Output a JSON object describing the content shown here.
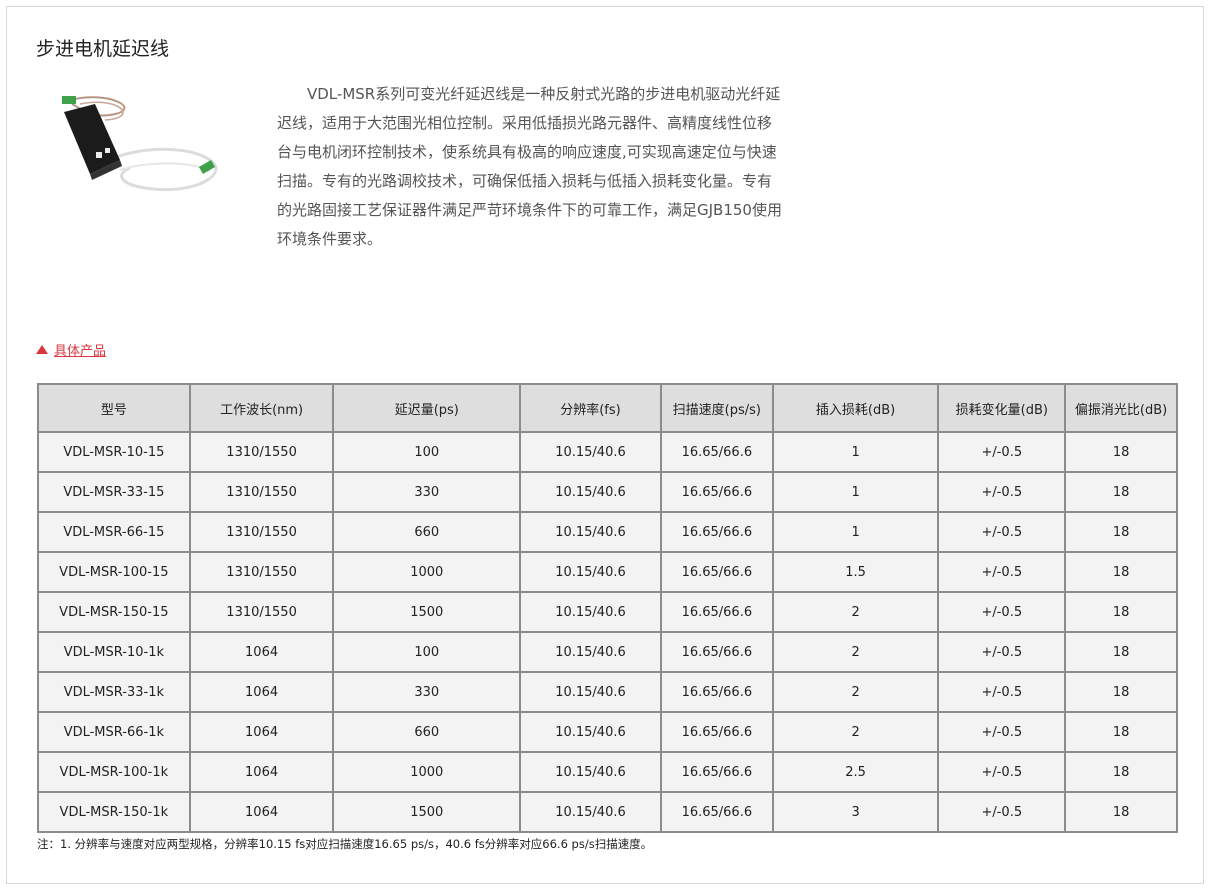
{
  "page": {
    "title": "步进电机延迟线",
    "description": "VDL-MSR系列可变光纤延迟线是一种反射式光路的步进电机驱动光纤延迟线，适用于大范围光相位控制。采用低插损光路元器件、高精度线性位移台与电机闭环控制技术，使系统具有极高的响应速度,可实现高速定位与快速扫描。专有的光路调校技术，可确保低插入损耗与低插入损耗变化量。专有的光路固接工艺保证器件满足严苛环境条件下的可靠工作，满足GJB150使用环境条件要求。",
    "section_link": "具体产品",
    "accent_color": "#d9363e",
    "image_icon": "fiber-delay-line-module"
  },
  "table": {
    "headers": [
      "型号",
      "工作波长(nm)",
      "延迟量(ps)",
      "分辨率(fs)",
      "扫描速度(ps/s)",
      "插入损耗(dB)",
      "损耗变化量(dB)",
      "偏振消光比(dB)"
    ],
    "rows": [
      [
        "VDL-MSR-10-15",
        "1310/1550",
        "100",
        "10.15/40.6",
        "16.65/66.6",
        "1",
        "+/-0.5",
        "18"
      ],
      [
        "VDL-MSR-33-15",
        "1310/1550",
        "330",
        "10.15/40.6",
        "16.65/66.6",
        "1",
        "+/-0.5",
        "18"
      ],
      [
        "VDL-MSR-66-15",
        "1310/1550",
        "660",
        "10.15/40.6",
        "16.65/66.6",
        "1",
        "+/-0.5",
        "18"
      ],
      [
        "VDL-MSR-100-15",
        "1310/1550",
        "1000",
        "10.15/40.6",
        "16.65/66.6",
        "1.5",
        "+/-0.5",
        "18"
      ],
      [
        "VDL-MSR-150-15",
        "1310/1550",
        "1500",
        "10.15/40.6",
        "16.65/66.6",
        "2",
        "+/-0.5",
        "18"
      ],
      [
        "VDL-MSR-10-1k",
        "1064",
        "100",
        "10.15/40.6",
        "16.65/66.6",
        "2",
        "+/-0.5",
        "18"
      ],
      [
        "VDL-MSR-33-1k",
        "1064",
        "330",
        "10.15/40.6",
        "16.65/66.6",
        "2",
        "+/-0.5",
        "18"
      ],
      [
        "VDL-MSR-66-1k",
        "1064",
        "660",
        "10.15/40.6",
        "16.65/66.6",
        "2",
        "+/-0.5",
        "18"
      ],
      [
        "VDL-MSR-100-1k",
        "1064",
        "1000",
        "10.15/40.6",
        "16.65/66.6",
        "2.5",
        "+/-0.5",
        "18"
      ],
      [
        "VDL-MSR-150-1k",
        "1064",
        "1500",
        "10.15/40.6",
        "16.65/66.6",
        "3",
        "+/-0.5",
        "18"
      ]
    ],
    "note": "注：1. 分辨率与速度对应两型规格，分辨率10.15 fs对应扫描速度16.65 ps/s，40.6 fs分辨率对应66.6 ps/s扫描速度。"
  }
}
